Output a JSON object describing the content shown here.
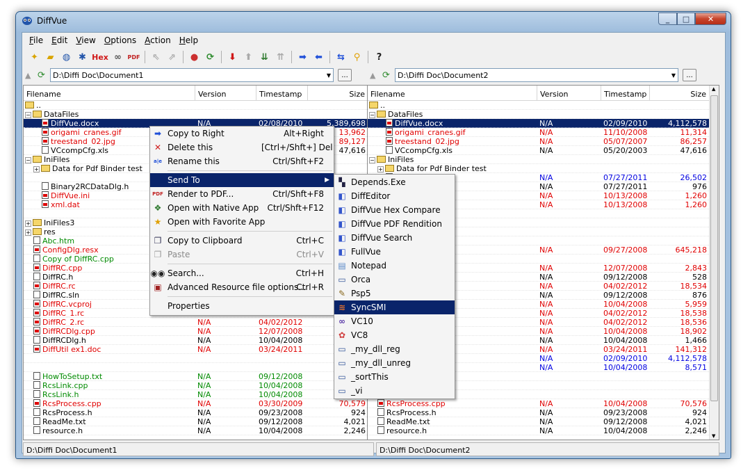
{
  "window": {
    "title": "DiffVue",
    "caption": {
      "minimize": "_",
      "maximize": "□",
      "close": "✕"
    }
  },
  "menu": [
    {
      "label": "File",
      "accel": "F",
      "rest": "ile"
    },
    {
      "label": "Edit",
      "accel": "E",
      "rest": "dit"
    },
    {
      "label": "View",
      "accel": "V",
      "rest": "iew"
    },
    {
      "label": "Options",
      "accel": "O",
      "rest": "ptions"
    },
    {
      "label": "Action",
      "accel": "A",
      "rest": "ction"
    },
    {
      "label": "Help",
      "accel": "H",
      "rest": "elp"
    }
  ],
  "toolbar": {
    "hex_label": "Hex",
    "help_glyph": "?"
  },
  "left": {
    "path": "D:\\Diffi Doc\\Document1",
    "dots": "...",
    "status": "D:\\Diffi Doc\\Document1"
  },
  "right": {
    "path": "D:\\Diffi Doc\\Document2",
    "dots": "...",
    "status": "D:\\Diffi Doc\\Document2"
  },
  "columns": {
    "filename": "Filename",
    "version": "Version",
    "timestamp": "Timestamp",
    "size": "Size"
  },
  "left_rows": [
    {
      "indent": 0,
      "icon": "folder",
      "name": ".."
    },
    {
      "indent": 0,
      "toggle": "−",
      "icon": "folder",
      "name": "DataFiles"
    },
    {
      "indent": 2,
      "icon": "file-red",
      "name": "DiffVue.docx",
      "version": "N/A",
      "ts": "02/08/2010",
      "size": "5,389,698",
      "color": "red",
      "sel": true
    },
    {
      "indent": 2,
      "icon": "file-red",
      "name": "origami_cranes.gif",
      "version": "",
      "ts": "",
      "size": "13,962",
      "color": "red"
    },
    {
      "indent": 2,
      "icon": "file-red",
      "name": "treestand_02.jpg",
      "version": "",
      "ts": "",
      "size": "89,127",
      "color": "red"
    },
    {
      "indent": 2,
      "icon": "file",
      "name": "VCcompCfg.xls",
      "version": "",
      "ts": "",
      "size": "47,616",
      "color": ""
    },
    {
      "indent": 0,
      "toggle": "−",
      "icon": "folder",
      "name": "IniFiles"
    },
    {
      "indent": 1,
      "toggle": "+",
      "icon": "folder",
      "name": "Data for Pdf Binder test"
    },
    {
      "indent": 2,
      "icon": "",
      "name": ""
    },
    {
      "indent": 2,
      "icon": "file",
      "name": "Binary2RCDataDlg.h",
      "color": ""
    },
    {
      "indent": 2,
      "icon": "file-red",
      "name": "DiffVue.ini",
      "color": "red"
    },
    {
      "indent": 2,
      "icon": "file-red",
      "name": "xml.dat",
      "color": "red"
    },
    {
      "indent": 0,
      "icon": "",
      "name": ""
    },
    {
      "indent": 0,
      "toggle": "+",
      "icon": "folder",
      "name": "IniFiles3"
    },
    {
      "indent": 0,
      "toggle": "+",
      "icon": "folder",
      "name": "res"
    },
    {
      "indent": 1,
      "icon": "file",
      "name": "Abc.htm",
      "color": "green"
    },
    {
      "indent": 1,
      "icon": "file-red",
      "name": "ConfigDlg.resx",
      "color": "red"
    },
    {
      "indent": 1,
      "icon": "file",
      "name": "Copy of DiffRC.cpp",
      "color": "green"
    },
    {
      "indent": 1,
      "icon": "file-red",
      "name": "DiffRC.cpp",
      "color": "red"
    },
    {
      "indent": 1,
      "icon": "file",
      "name": "DiffRC.h",
      "color": ""
    },
    {
      "indent": 1,
      "icon": "file-red",
      "name": "DiffRC.rc",
      "color": "red"
    },
    {
      "indent": 1,
      "icon": "file",
      "name": "DiffRC.sln",
      "color": ""
    },
    {
      "indent": 1,
      "icon": "file-red",
      "name": "DiffRC.vcproj",
      "color": "red"
    },
    {
      "indent": 1,
      "icon": "file-red",
      "name": "DiffRC_1.rc",
      "version": "",
      "ts": "",
      "size": "",
      "color": "red"
    },
    {
      "indent": 1,
      "icon": "file-red",
      "name": "DiffRC_2.rc",
      "version": "N/A",
      "ts": "04/02/2012",
      "size": "",
      "color": "red"
    },
    {
      "indent": 1,
      "icon": "file-red",
      "name": "DiffRCDlg.cpp",
      "version": "N/A",
      "ts": "12/07/2008",
      "size": "",
      "color": "red"
    },
    {
      "indent": 1,
      "icon": "file",
      "name": "DiffRCDlg.h",
      "version": "N/A",
      "ts": "10/04/2008",
      "size": "",
      "color": ""
    },
    {
      "indent": 1,
      "icon": "file-red",
      "name": "DiffUtil ex1.doc",
      "version": "N/A",
      "ts": "03/24/2011",
      "size": "",
      "color": "red"
    },
    {
      "indent": 1,
      "icon": "",
      "name": ""
    },
    {
      "indent": 1,
      "icon": "",
      "name": ""
    },
    {
      "indent": 1,
      "icon": "file",
      "name": "HowToSetup.txt",
      "version": "N/A",
      "ts": "09/12/2008",
      "size": "",
      "color": "green"
    },
    {
      "indent": 1,
      "icon": "file",
      "name": "RcsLink.cpp",
      "version": "N/A",
      "ts": "10/04/2008",
      "size": "",
      "color": "green"
    },
    {
      "indent": 1,
      "icon": "file",
      "name": "RcsLink.h",
      "version": "N/A",
      "ts": "10/04/2008",
      "size": "",
      "color": "green"
    },
    {
      "indent": 1,
      "icon": "file-red",
      "name": "RcsProcess.cpp",
      "version": "N/A",
      "ts": "03/30/2009",
      "size": "70,579",
      "color": "red"
    },
    {
      "indent": 1,
      "icon": "file",
      "name": "RcsProcess.h",
      "version": "N/A",
      "ts": "09/23/2008",
      "size": "924",
      "color": ""
    },
    {
      "indent": 1,
      "icon": "file",
      "name": "ReadMe.txt",
      "version": "N/A",
      "ts": "09/12/2008",
      "size": "4,021",
      "color": ""
    },
    {
      "indent": 1,
      "icon": "file",
      "name": "resource.h",
      "version": "N/A",
      "ts": "10/04/2008",
      "size": "2,246",
      "color": ""
    }
  ],
  "right_rows": [
    {
      "indent": 0,
      "icon": "folder",
      "name": ".."
    },
    {
      "indent": 0,
      "toggle": "−",
      "icon": "folder",
      "name": "DataFiles"
    },
    {
      "indent": 2,
      "icon": "file-red",
      "name": "DiffVue.docx",
      "version": "N/A",
      "ts": "02/09/2010",
      "size": "4,112,578",
      "color": "red",
      "sel": true
    },
    {
      "indent": 2,
      "icon": "file-red",
      "name": "origami_cranes.gif",
      "version": "N/A",
      "ts": "11/10/2008",
      "size": "11,314",
      "color": "red"
    },
    {
      "indent": 2,
      "icon": "file-red",
      "name": "treestand_02.jpg",
      "version": "N/A",
      "ts": "05/07/2007",
      "size": "86,257",
      "color": "red"
    },
    {
      "indent": 2,
      "icon": "file",
      "name": "VCcompCfg.xls",
      "version": "N/A",
      "ts": "05/20/2003",
      "size": "47,616",
      "color": ""
    },
    {
      "indent": 0,
      "toggle": "−",
      "icon": "folder",
      "name": "IniFiles"
    },
    {
      "indent": 1,
      "toggle": "+",
      "icon": "folder",
      "name": "Data for Pdf Binder test"
    },
    {
      "indent": 2,
      "icon": "file",
      "name": "",
      "version": "N/A",
      "ts": "07/27/2011",
      "size": "26,502",
      "color": "blue"
    },
    {
      "indent": 2,
      "icon": "file",
      "name": "",
      "version": "N/A",
      "ts": "07/27/2011",
      "size": "976",
      "color": ""
    },
    {
      "indent": 2,
      "icon": "file-red",
      "name": "",
      "version": "N/A",
      "ts": "10/13/2008",
      "size": "1,260",
      "color": "red"
    },
    {
      "indent": 2,
      "icon": "file-red",
      "name": "",
      "version": "N/A",
      "ts": "10/13/2008",
      "size": "1,260",
      "color": "red"
    },
    {
      "indent": 0,
      "icon": "",
      "name": ""
    },
    {
      "indent": 0,
      "icon": "",
      "name": ""
    },
    {
      "indent": 0,
      "icon": "",
      "name": ""
    },
    {
      "indent": 1,
      "icon": "",
      "name": ""
    },
    {
      "indent": 1,
      "icon": "",
      "name": "",
      "version": "N/A",
      "ts": "09/27/2008",
      "size": "645,218",
      "color": "red"
    },
    {
      "indent": 1,
      "icon": "",
      "name": ""
    },
    {
      "indent": 1,
      "icon": "",
      "name": "",
      "version": "N/A",
      "ts": "12/07/2008",
      "size": "2,843",
      "color": "red"
    },
    {
      "indent": 1,
      "icon": "",
      "name": "",
      "version": "N/A",
      "ts": "09/12/2008",
      "size": "528",
      "color": ""
    },
    {
      "indent": 1,
      "icon": "",
      "name": "",
      "version": "N/A",
      "ts": "04/02/2012",
      "size": "18,534",
      "color": "red"
    },
    {
      "indent": 1,
      "icon": "",
      "name": "",
      "version": "N/A",
      "ts": "09/12/2008",
      "size": "876",
      "color": ""
    },
    {
      "indent": 1,
      "icon": "",
      "name": "",
      "version": "N/A",
      "ts": "10/04/2008",
      "size": "5,959",
      "color": "red"
    },
    {
      "indent": 1,
      "icon": "",
      "name": "",
      "version": "N/A",
      "ts": "04/02/2012",
      "size": "18,538",
      "color": "red"
    },
    {
      "indent": 1,
      "icon": "",
      "name": "",
      "version": "N/A",
      "ts": "04/02/2012",
      "size": "18,536",
      "color": "red"
    },
    {
      "indent": 1,
      "icon": "",
      "name": "",
      "version": "N/A",
      "ts": "10/04/2008",
      "size": "18,902",
      "color": "red"
    },
    {
      "indent": 1,
      "icon": "",
      "name": "",
      "version": "N/A",
      "ts": "10/04/2008",
      "size": "1,466",
      "color": ""
    },
    {
      "indent": 1,
      "icon": "",
      "name": "",
      "version": "N/A",
      "ts": "03/24/2011",
      "size": "141,312",
      "color": "red"
    },
    {
      "indent": 1,
      "icon": "",
      "name": "",
      "version": "N/A",
      "ts": "02/09/2010",
      "size": "4,112,578",
      "color": "blue"
    },
    {
      "indent": 1,
      "icon": "",
      "name": "",
      "version": "N/A",
      "ts": "10/04/2008",
      "size": "8,571",
      "color": "blue"
    },
    {
      "indent": 1,
      "icon": "",
      "name": ""
    },
    {
      "indent": 1,
      "icon": "",
      "name": ""
    },
    {
      "indent": 1,
      "icon": "",
      "name": ""
    },
    {
      "indent": 1,
      "icon": "file-red",
      "name": "RcsProcess.cpp",
      "version": "N/A",
      "ts": "10/04/2008",
      "size": "70,576",
      "color": "red"
    },
    {
      "indent": 1,
      "icon": "file",
      "name": "RcsProcess.h",
      "version": "N/A",
      "ts": "09/23/2008",
      "size": "924",
      "color": ""
    },
    {
      "indent": 1,
      "icon": "file",
      "name": "ReadMe.txt",
      "version": "N/A",
      "ts": "09/12/2008",
      "size": "4,021",
      "color": ""
    },
    {
      "indent": 1,
      "icon": "file",
      "name": "resource.h",
      "version": "N/A",
      "ts": "10/04/2008",
      "size": "2,246",
      "color": ""
    }
  ],
  "context_menu": [
    {
      "label": "Copy to Right",
      "shortcut": "Alt+Right",
      "icon": "arrow-right-icon",
      "glyph": "➡",
      "color": "#1f4fd8"
    },
    {
      "label": "Delete this",
      "shortcut": "[Ctrl+/Shft+] Del",
      "icon": "delete-x-icon",
      "glyph": "✕",
      "color": "#d02020"
    },
    {
      "label": "Rename this",
      "shortcut": "Ctrl/Shft+F2",
      "icon": "rename-icon",
      "glyph": "a|e",
      "color": "#1f4fd8"
    },
    {
      "sep": true
    },
    {
      "label": "Send To",
      "shortcut": "",
      "icon": "",
      "glyph": "",
      "submenu": true,
      "hl": true
    },
    {
      "label": "Render to PDF...",
      "shortcut": "Ctrl/Shft+F8",
      "icon": "pdf-icon",
      "glyph": "PDF",
      "color": "#c02020"
    },
    {
      "label": "Open with Native App",
      "shortcut": "Ctrl/Shft+F12",
      "icon": "native-app-icon",
      "glyph": "❖",
      "color": "#2f7a2f"
    },
    {
      "label": "Open with Favorite App",
      "shortcut": "",
      "icon": "favorite-star-icon",
      "glyph": "★",
      "color": "#e0a000"
    },
    {
      "sep": true
    },
    {
      "label": "Copy to Clipboard",
      "shortcut": "Ctrl+C",
      "icon": "clipboard-copy-icon",
      "glyph": "❐",
      "color": "#335"
    },
    {
      "label": "Paste",
      "shortcut": "Ctrl+V",
      "icon": "paste-icon",
      "glyph": "❐",
      "color": "#999",
      "disabled": true
    },
    {
      "sep": true
    },
    {
      "label": "Search...",
      "shortcut": "Ctrl+H",
      "icon": "binoculars-icon",
      "glyph": "◉◉",
      "color": "#222"
    },
    {
      "label": "Advanced Resource file options...",
      "shortcut": "Ctrl+R",
      "icon": "resource-icon",
      "glyph": "▣",
      "color": "#a02020"
    },
    {
      "sep": true
    },
    {
      "label": "Properties",
      "shortcut": "",
      "icon": "",
      "glyph": ""
    }
  ],
  "send_to": [
    {
      "label": "Depends.Exe",
      "icon": "depends-icon",
      "glyph": "▚",
      "color": "#224"
    },
    {
      "label": "DiffEditor",
      "icon": "diffeditor-icon",
      "glyph": "◧",
      "color": "#3355cc"
    },
    {
      "label": "DiffVue Hex Compare",
      "icon": "hex-compare-icon",
      "glyph": "◧",
      "color": "#3355cc"
    },
    {
      "label": "DiffVue PDF Rendition",
      "icon": "pdf-rendition-icon",
      "glyph": "◧",
      "color": "#3355cc"
    },
    {
      "label": "DiffVue Search",
      "icon": "diffvue-search-icon",
      "glyph": "◧",
      "color": "#3355cc"
    },
    {
      "label": "FullVue",
      "icon": "fullvue-icon",
      "glyph": "◧",
      "color": "#3355cc"
    },
    {
      "label": "Notepad",
      "icon": "notepad-icon",
      "glyph": "▤",
      "color": "#5a88c8"
    },
    {
      "label": "Orca",
      "icon": "orca-icon",
      "glyph": "▭",
      "color": "#335599"
    },
    {
      "label": "Psp5",
      "icon": "psp-icon",
      "glyph": "✎",
      "color": "#8a6a20"
    },
    {
      "label": "SyncSMI",
      "icon": "syncsmi-icon",
      "glyph": "≋",
      "color": "#e07030",
      "hl": true
    },
    {
      "label": "VC10",
      "icon": "vc10-icon",
      "glyph": "∞",
      "color": "#5a3aa8"
    },
    {
      "label": "VC8",
      "icon": "vc8-icon",
      "glyph": "✿",
      "color": "#d04040"
    },
    {
      "label": "_my_dll_reg",
      "icon": "window-icon",
      "glyph": "▭",
      "color": "#335599"
    },
    {
      "label": "_my_dll_unreg",
      "icon": "window-icon",
      "glyph": "▭",
      "color": "#335599"
    },
    {
      "label": "_sortThis",
      "icon": "window-icon",
      "glyph": "▭",
      "color": "#335599"
    },
    {
      "label": "_vi",
      "icon": "window-icon",
      "glyph": "▭",
      "color": "#335599"
    }
  ]
}
